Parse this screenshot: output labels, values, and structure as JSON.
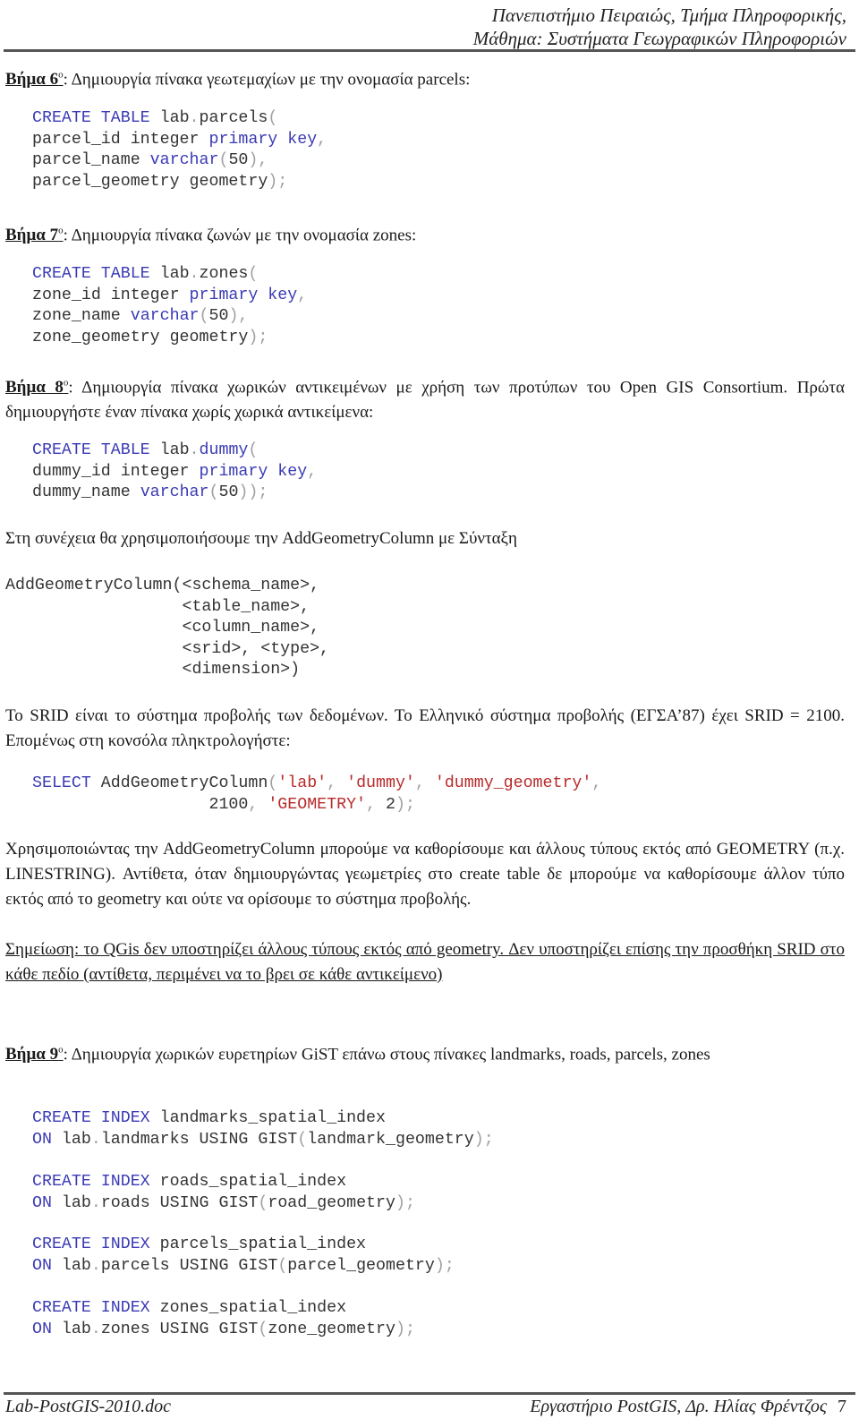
{
  "header": {
    "line1": "Πανεπιστήμιο Πειραιώς, Τμήμα Πληροφορικής,",
    "line2": "Μάθημα: Συστήματα Γεωγραφικών Πληροφοριών"
  },
  "steps": {
    "step6": {
      "label": "Βήμα 6",
      "sup": "ο",
      "text": ": Δημιουργία πίνακα γεωτεμαχίων με την ονομασία parcels:"
    },
    "step7": {
      "label": "Βήμα 7",
      "sup": "ο",
      "text": ": Δημιουργία πίνακα ζωνών με την ονομασία zones:"
    },
    "step8": {
      "label": "Βήμα 8",
      "sup": "ο",
      "text": ": Δημιουργία πίνακα χωρικών αντικειμένων με χρήση των προτύπων του Open GIS Consortium. Πρώτα δημιουργήστε έναν πίνακα χωρίς χωρικά αντικείμενα:"
    },
    "step9": {
      "label": "Βήμα 9",
      "sup": "ο",
      "text": ": Δημιουργία χωρικών ευρετηρίων GiST επάνω στους πίνακες landmarks, roads, parcels, zones"
    }
  },
  "code": {
    "parcels": [
      [
        [
          "kw",
          "CREATE TABLE "
        ],
        [
          "tx",
          "lab"
        ],
        [
          "pn",
          "."
        ],
        [
          "tx",
          "parcels"
        ],
        [
          "pn",
          "("
        ]
      ],
      [
        [
          "tx",
          "parcel_id integer "
        ],
        [
          "kw",
          "primary key"
        ],
        [
          "pn",
          ","
        ]
      ],
      [
        [
          "tx",
          "parcel_name "
        ],
        [
          "kw",
          "varchar"
        ],
        [
          "pn",
          "("
        ],
        [
          "tx",
          "50"
        ],
        [
          "pn",
          "),"
        ]
      ],
      [
        [
          "tx",
          "parcel_geometry geometry"
        ],
        [
          "pn",
          ");"
        ]
      ]
    ],
    "zones": [
      [
        [
          "kw",
          "CREATE TABLE "
        ],
        [
          "tx",
          "lab"
        ],
        [
          "pn",
          "."
        ],
        [
          "tx",
          "zones"
        ],
        [
          "pn",
          "("
        ]
      ],
      [
        [
          "tx",
          "zone_id integer "
        ],
        [
          "kw",
          "primary key"
        ],
        [
          "pn",
          ","
        ]
      ],
      [
        [
          "tx",
          "zone_name "
        ],
        [
          "kw",
          "varchar"
        ],
        [
          "pn",
          "("
        ],
        [
          "tx",
          "50"
        ],
        [
          "pn",
          "),"
        ]
      ],
      [
        [
          "tx",
          "zone_geometry geometry"
        ],
        [
          "pn",
          ");"
        ]
      ]
    ],
    "dummy": [
      [
        [
          "kw",
          "CREATE TABLE "
        ],
        [
          "tx",
          "lab"
        ],
        [
          "pn",
          "."
        ],
        [
          "kw",
          "dummy"
        ],
        [
          "pn",
          "("
        ]
      ],
      [
        [
          "tx",
          "dummy_id integer "
        ],
        [
          "kw",
          "primary key"
        ],
        [
          "pn",
          ","
        ]
      ],
      [
        [
          "tx",
          "dummy_name "
        ],
        [
          "kw",
          "varchar"
        ],
        [
          "pn",
          "("
        ],
        [
          "tx",
          "50"
        ],
        [
          "pn",
          "));"
        ]
      ]
    ],
    "syntax": [
      [
        [
          "tx",
          "AddGeometryColumn(<schema_name>,"
        ]
      ],
      [
        [
          "tx",
          "                  <table_name>,"
        ]
      ],
      [
        [
          "tx",
          "                  <column_name>,"
        ]
      ],
      [
        [
          "tx",
          "                  <srid>, <type>,"
        ]
      ],
      [
        [
          "tx",
          "                  <dimension>)"
        ]
      ]
    ],
    "select": [
      [
        [
          "kw",
          "SELECT "
        ],
        [
          "tx",
          "AddGeometryColumn"
        ],
        [
          "pn",
          "("
        ],
        [
          "st",
          "'lab'"
        ],
        [
          "pn",
          ", "
        ],
        [
          "st",
          "'dummy'"
        ],
        [
          "pn",
          ", "
        ],
        [
          "st",
          "'dummy_geometry'"
        ],
        [
          "pn",
          ","
        ]
      ],
      [
        [
          "tx",
          "                  2100"
        ],
        [
          "pn",
          ", "
        ],
        [
          "st",
          "'GEOMETRY'"
        ],
        [
          "pn",
          ", "
        ],
        [
          "tx",
          "2"
        ],
        [
          "pn",
          ");"
        ]
      ]
    ],
    "idx_landmarks": [
      [
        [
          "kw",
          "CREATE INDEX "
        ],
        [
          "tx",
          "landmarks_spatial_index"
        ]
      ],
      [
        [
          "kw",
          "ON "
        ],
        [
          "tx",
          "lab"
        ],
        [
          "pn",
          "."
        ],
        [
          "tx",
          "landmarks USING GIST"
        ],
        [
          "pn",
          "("
        ],
        [
          "tx",
          "landmark_geometry"
        ],
        [
          "pn",
          ");"
        ]
      ]
    ],
    "idx_roads": [
      [
        [
          "kw",
          "CREATE INDEX "
        ],
        [
          "tx",
          "roads_spatial_index"
        ]
      ],
      [
        [
          "kw",
          "ON "
        ],
        [
          "tx",
          "lab"
        ],
        [
          "pn",
          "."
        ],
        [
          "tx",
          "roads USING GIST"
        ],
        [
          "pn",
          "("
        ],
        [
          "tx",
          "road_geometry"
        ],
        [
          "pn",
          ");"
        ]
      ]
    ],
    "idx_parcels": [
      [
        [
          "kw",
          "CREATE INDEX "
        ],
        [
          "tx",
          "parcels_spatial_index"
        ]
      ],
      [
        [
          "kw",
          "ON "
        ],
        [
          "tx",
          "lab"
        ],
        [
          "pn",
          "."
        ],
        [
          "tx",
          "parcels USING GIST"
        ],
        [
          "pn",
          "("
        ],
        [
          "tx",
          "parcel_geometry"
        ],
        [
          "pn",
          ");"
        ]
      ]
    ],
    "idx_zones": [
      [
        [
          "kw",
          "CREATE INDEX "
        ],
        [
          "tx",
          "zones_spatial_index"
        ]
      ],
      [
        [
          "kw",
          "ON "
        ],
        [
          "tx",
          "lab"
        ],
        [
          "pn",
          "."
        ],
        [
          "tx",
          "zones USING GIST"
        ],
        [
          "pn",
          "("
        ],
        [
          "tx",
          "zone_geometry"
        ],
        [
          "pn",
          ");"
        ]
      ]
    ]
  },
  "paragraphs": {
    "then_use": "Στη συνέχεια θα χρησιμοποιήσουμε την AddGeometryColumn με Σύνταξη",
    "srid": "Το SRID είναι το σύστημα προβολής των δεδομένων. Το Ελληνικό σύστημα προβολής (ΕΓΣΑ’87) έχει SRID = 2100. Επομένως στη κονσόλα πληκτρολογήστε:",
    "using": "Χρησιμοποιώντας την AddGeometryColumn μπορούμε να καθορίσουμε και άλλους τύπους εκτός από GEOMETRY (π.χ. LINESTRING). Αντίθετα, όταν δημιουργώντας γεωμετρίες στο create table δε μπορούμε να καθορίσουμε άλλον τύπο εκτός από το geometry και ούτε να ορίσουμε το σύστημα προβολής.",
    "note": "Σημείωση: το QGis δεν υποστηρίζει άλλους τύπους εκτός από geometry. Δεν υποστηρίζει επίσης την προσθήκη SRID στο κάθε πεδίο (αντίθετα, περιμένει να το βρει σε κάθε αντικείμενο)"
  },
  "footer": {
    "filename": "Lab-PostGIS-2010.doc",
    "course": "Εργαστήριο PostGIS, Δρ. Ηλίας Φρέντζος",
    "page": "7"
  },
  "colors": {
    "keyword": "#3a3ab5",
    "string": "#b82a2a",
    "punctuation": "#a0a0a0",
    "text": "#333333"
  }
}
